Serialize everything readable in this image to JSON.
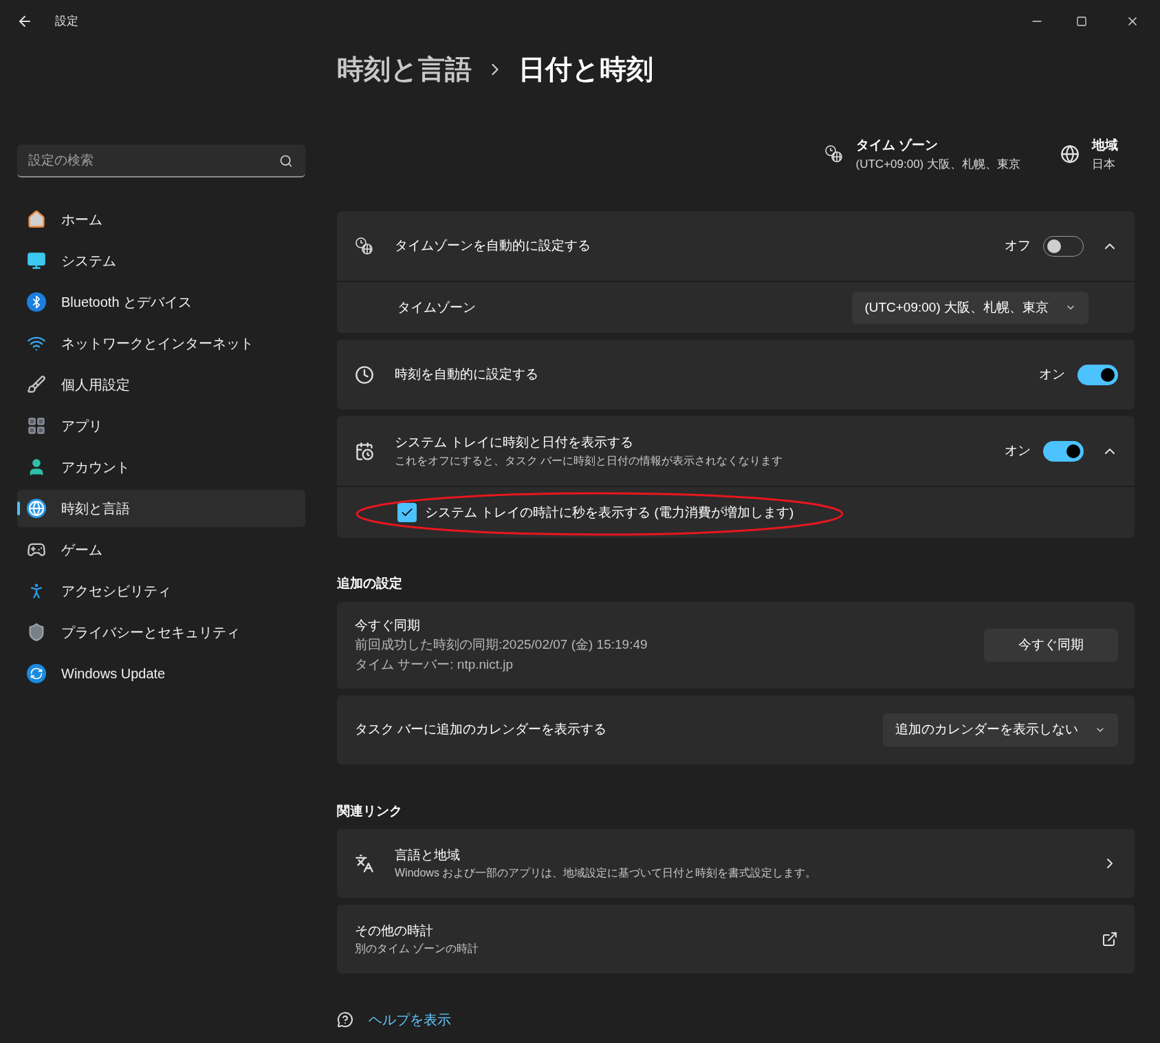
{
  "window": {
    "title": "設定"
  },
  "search": {
    "placeholder": "設定の検索"
  },
  "nav": [
    {
      "label": "ホーム",
      "selected": false
    },
    {
      "label": "システム",
      "selected": false
    },
    {
      "label": "Bluetooth とデバイス",
      "selected": false
    },
    {
      "label": "ネットワークとインターネット",
      "selected": false
    },
    {
      "label": "個人用設定",
      "selected": false
    },
    {
      "label": "アプリ",
      "selected": false
    },
    {
      "label": "アカウント",
      "selected": false
    },
    {
      "label": "時刻と言語",
      "selected": true
    },
    {
      "label": "ゲーム",
      "selected": false
    },
    {
      "label": "アクセシビリティ",
      "selected": false
    },
    {
      "label": "プライバシーとセキュリティ",
      "selected": false
    },
    {
      "label": "Windows Update",
      "selected": false
    }
  ],
  "breadcrumb": [
    "時刻と言語",
    "日付と時刻"
  ],
  "summary": [
    {
      "title": "タイム ゾーン",
      "value": "(UTC+09:00) 大阪、札幌、東京"
    },
    {
      "title": "地域",
      "value": "日本"
    }
  ],
  "cards": [
    {
      "title": "タイムゾーンを自動的に設定する",
      "toggle": {
        "label": "オフ",
        "on": false
      },
      "expanded": true,
      "children": [
        {
          "kind": "dropdown",
          "label": "タイムゾーン",
          "value": "(UTC+09:00) 大阪、札幌、東京"
        }
      ]
    },
    {
      "title": "時刻を自動的に設定する",
      "toggle": {
        "label": "オン",
        "on": true
      }
    },
    {
      "title": "システム トレイに時刻と日付を表示する",
      "description": "これをオフにすると、タスク バーに時刻と日付の情報が表示されなくなります",
      "toggle": {
        "label": "オン",
        "on": true
      },
      "expanded": true,
      "children": [
        {
          "kind": "checkbox",
          "label": "システム トレイの時計に秒を表示する (電力消費が増加します)",
          "checked": true
        }
      ]
    }
  ],
  "additional": {
    "heading": "追加の設定",
    "cards": [
      {
        "kind": "button",
        "title": "今すぐ同期",
        "lines": [
          "前回成功した時刻の同期:2025/02/07 (金) 15:19:49",
          "タイム サーバー: ntp.nict.jp"
        ],
        "button": "今すぐ同期"
      },
      {
        "kind": "dropdown",
        "title": "タスク バーに追加のカレンダーを表示する",
        "value": "追加のカレンダーを表示しない"
      }
    ]
  },
  "related": {
    "heading": "関連リンク",
    "links": [
      {
        "kind": "chevron",
        "title": "言語と地域",
        "description": "Windows および一部のアプリは、地域設定に基づいて日付と時刻を書式設定します。"
      },
      {
        "kind": "external",
        "title": "その他の時計",
        "description": "別のタイム ゾーンの時計"
      }
    ]
  },
  "help": {
    "label": "ヘルプを表示"
  }
}
